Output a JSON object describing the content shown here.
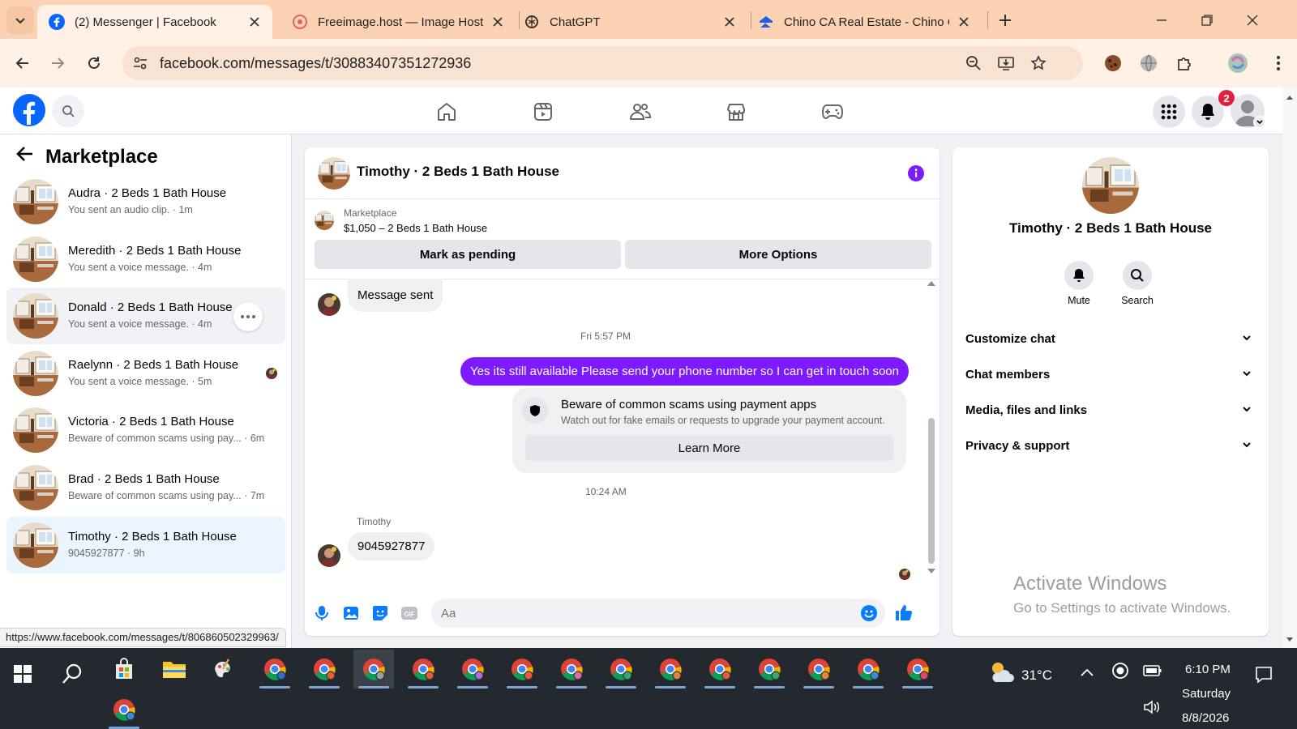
{
  "browser": {
    "tabs": [
      {
        "title": "(2) Messenger | Facebook",
        "active": true,
        "icon": "facebook-icon"
      },
      {
        "title": "Freeimage.host — Image Hostin",
        "active": false,
        "icon": "freeimage-icon"
      },
      {
        "title": "ChatGPT",
        "active": false,
        "icon": "chatgpt-icon"
      },
      {
        "title": "Chino CA Real Estate - Chino CA",
        "active": false,
        "icon": "zillow-icon"
      }
    ],
    "address": "facebook.com/messages/t/30883407351272936",
    "status_url": "https://www.facebook.com/messages/t/806860502329963/"
  },
  "fb": {
    "notification_count": "2",
    "accent": "#7d1aff"
  },
  "sidebar": {
    "title": "Marketplace",
    "conversations": [
      {
        "name": "Audra · 2 Beds 1 Bath House",
        "preview": "You sent an audio clip. · 1m"
      },
      {
        "name": "Meredith · 2 Beds 1 Bath House",
        "preview": "You sent a voice message. · 4m"
      },
      {
        "name": "Donald · 2 Beds 1 Bath House",
        "preview": "You sent a voice message. · 4m",
        "state": "hover"
      },
      {
        "name": "Raelynn · 2 Beds 1 Bath House",
        "preview": "You sent a voice message. · 5m",
        "seen_avatar": true
      },
      {
        "name": "Victoria · 2 Beds 1 Bath House",
        "preview": "Beware of common scams using pay... · 6m"
      },
      {
        "name": "Brad · 2 Beds 1 Bath House",
        "preview": "Beware of common scams using pay... · 7m"
      },
      {
        "name": "Timothy · 2 Beds 1 Bath House",
        "preview": "9045927877 · 9h",
        "state": "selected"
      }
    ]
  },
  "chat": {
    "title": "Timothy · 2 Beds 1 Bath House",
    "listing": {
      "label": "Marketplace",
      "price": "$1,050 – 2 Beds 1 Bath House"
    },
    "mark_pending": "Mark as pending",
    "more_options": "More Options",
    "msg_sent": "Message sent",
    "time1": "Fri 5:57 PM",
    "outgoing": "Yes its still available Please send your phone number so I can get in touch soon",
    "scam_title": "Beware of common scams using payment apps",
    "scam_body": "Watch out for fake emails or requests to upgrade your payment account.",
    "learn_more": "Learn More",
    "time2": "10:24 AM",
    "sender": "Timothy",
    "incoming": "9045927877",
    "composer_placeholder": "Aa"
  },
  "details": {
    "name": "Timothy · 2 Beds 1 Bath House",
    "mute": "Mute",
    "search": "Search",
    "sections": [
      "Customize chat",
      "Chat members",
      "Media, files and links",
      "Privacy & support"
    ]
  },
  "windows": {
    "watermark_title": "Activate Windows",
    "watermark_sub": "Go to Settings to activate Windows.",
    "weather": "31°C",
    "time": "6:10 PM",
    "day": "Saturday",
    "date": "8/8/2026"
  }
}
